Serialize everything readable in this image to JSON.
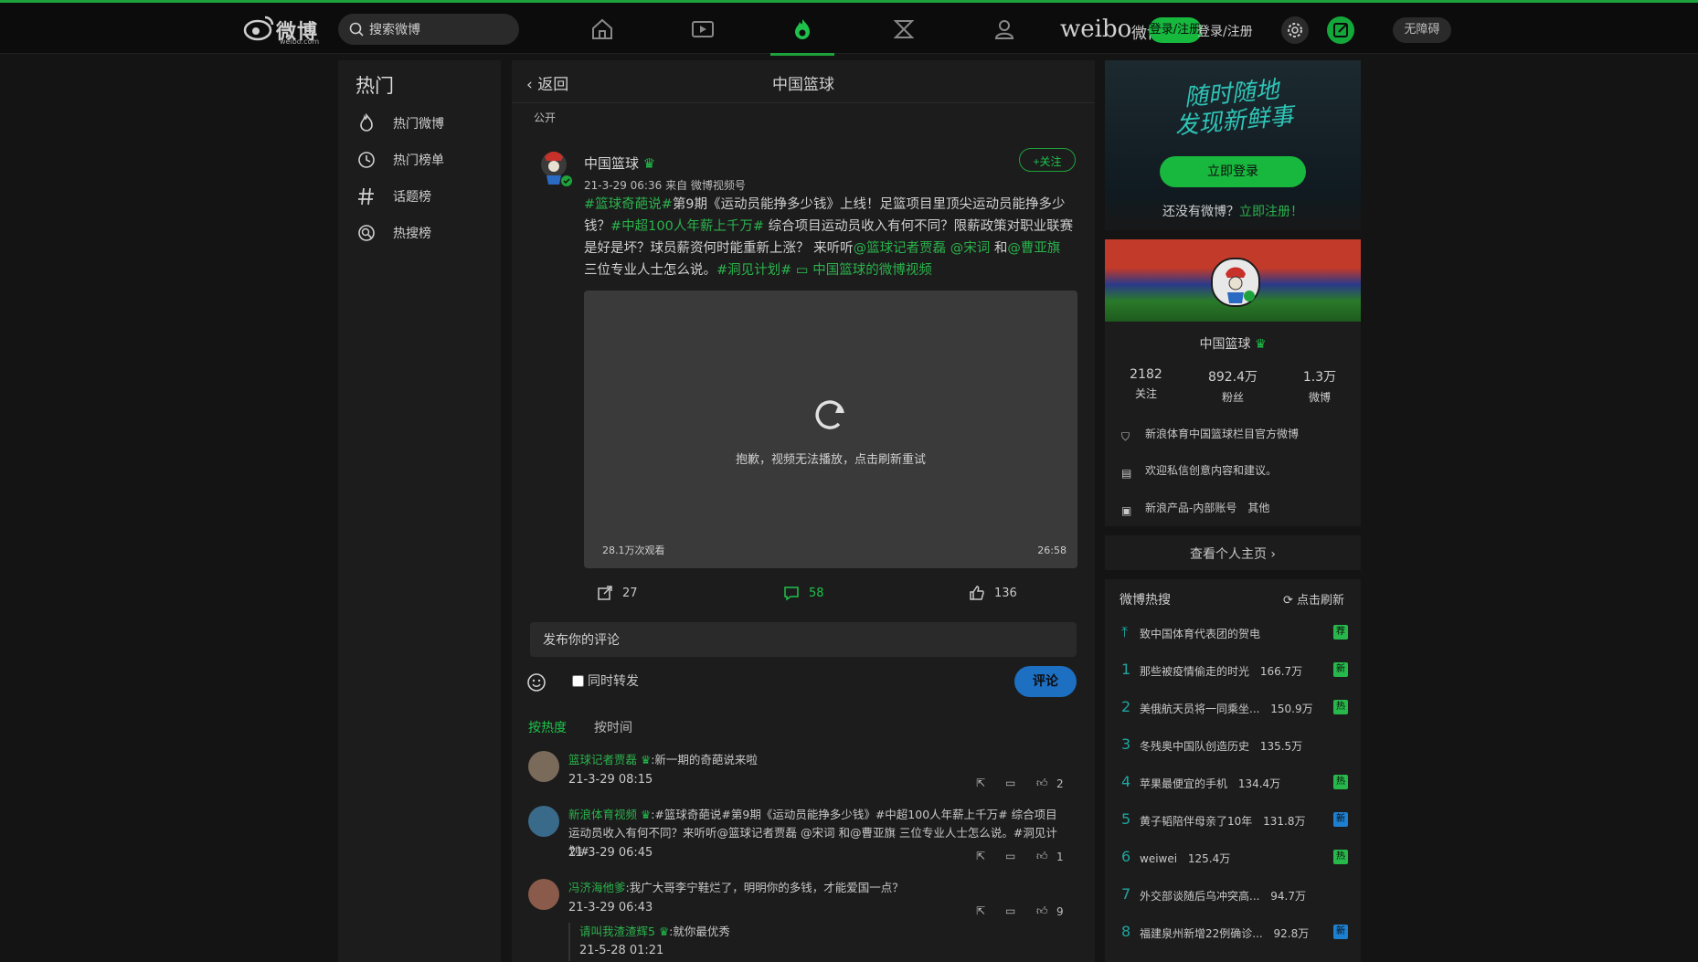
{
  "header": {
    "logo_text": "微博",
    "logo_sub": "weibo.com",
    "search_placeholder": "搜索微博",
    "brand": "weibo",
    "brand_cn": "微博",
    "login_pill": "登录/注册",
    "login_links": "登录/注册",
    "sound_label": "无障碍"
  },
  "left": {
    "title": "热门",
    "items": [
      {
        "label": "热门微博",
        "icon": "fire-icon"
      },
      {
        "label": "热门榜单",
        "icon": "clock-icon"
      },
      {
        "label": "话题榜",
        "icon": "hashtag-icon"
      },
      {
        "label": "热搜榜",
        "icon": "search-circle-icon"
      }
    ]
  },
  "post": {
    "back_label": "返回",
    "title": "中国篮球",
    "visibility": "公开",
    "author": "中国篮球",
    "time": "21-3-29 06:36",
    "source": "来自 微博视频号",
    "follow_label": "+关注",
    "text_segments": [
      {
        "t": "#篮球奇葩说#",
        "link": true
      },
      {
        "t": "第9期《运动员能挣多少钱》上线！足篮项目里顶尖运动员能挣多少钱？",
        "link": false
      },
      {
        "t": "#中超100人年薪上千万#",
        "link": true
      },
      {
        "t": " 综合项目运动员收入有何不同？限薪政策对职业联赛是好是坏？球员薪资何时能重新上涨？ 来听听",
        "link": false
      },
      {
        "t": "@篮球记者贾磊",
        "link": true
      },
      {
        "t": " ",
        "link": false
      },
      {
        "t": "@宋词",
        "link": true
      },
      {
        "t": " 和",
        "link": false
      },
      {
        "t": "@曹亚旗",
        "link": true
      },
      {
        "t": " 三位专业人士怎么说。",
        "link": false
      },
      {
        "t": "#洞见计划#",
        "link": true
      },
      {
        "t": " ",
        "link": false
      },
      {
        "t": "▭ 中国篮球的微博视频",
        "link": true
      }
    ],
    "video_message": "抱歉，视频无法播放，点击刷新重试",
    "video_views": "28.1万次观看",
    "video_duration": "26:58",
    "reposts": "27",
    "comments": "58",
    "likes": "136",
    "comment_placeholder": "发布你的评论",
    "forward_label": "同时转发",
    "submit_label": "评论",
    "sort_hot": "按热度",
    "sort_time": "按时间"
  },
  "comments": [
    {
      "user": "篮球记者贾磊",
      "text": ":新一期的奇葩说来啦",
      "time": "21-3-29 08:15",
      "likes": "2"
    },
    {
      "user": "新浪体育视频",
      "text": ":#篮球奇葩说#第9期《运动员能挣多少钱》#中超100人年薪上千万# 综合项目运动员收入有何不同？来听听@篮球记者贾磊 @宋词 和@曹亚旗 三位专业人士怎么说。#洞见计划#",
      "time": "21-3-29 06:45",
      "likes": "1"
    },
    {
      "user": "冯济海他爹",
      "text": ":我广大哥李宁鞋烂了，明明你的多钱，才能爱国一点？",
      "time": "21-3-29 06:43",
      "likes": "9"
    }
  ],
  "reply": {
    "user": "请叫我渣渣辉5",
    "text": ":就你最优秀",
    "time": "21-5-28 01:21"
  },
  "right": {
    "slogan_line1": "随时随地",
    "slogan_line2": "发现新鲜事",
    "login_button": "立即登录",
    "no_account": "还没有微博？",
    "register": "立即注册！",
    "profile_name": "中国篮球",
    "stats": [
      {
        "value": "2182",
        "label": "关注"
      },
      {
        "value": "892.4万",
        "label": "粉丝"
      },
      {
        "value": "1.3万",
        "label": "微博"
      }
    ],
    "info": [
      {
        "text": "新浪体育中国篮球栏目官方微博",
        "icon": "shield-icon"
      },
      {
        "text": "欢迎私信创意内容和建议。",
        "icon": "document-icon"
      },
      {
        "text": "新浪产品-内部账号　其他",
        "icon": "card-icon"
      }
    ],
    "view_home": "查看个人主页",
    "hot_title": "微博热搜",
    "hot_refresh": "点击刷新",
    "hot_items": [
      {
        "rank": "",
        "title": "致中国体育代表团的贺电",
        "heat": "",
        "badge": "荐",
        "badge_color": "#27b84b"
      },
      {
        "rank": "1",
        "title": "那些被疫情偷走的时光",
        "heat": "166.7万",
        "badge": "新",
        "badge_color": "#27b84b"
      },
      {
        "rank": "2",
        "title": "美俄航天员将一同乘坐...",
        "heat": "150.9万",
        "badge": "热",
        "badge_color": "#27b84b"
      },
      {
        "rank": "3",
        "title": "冬残奥中国队创造历史",
        "heat": "135.5万",
        "badge": "",
        "badge_color": ""
      },
      {
        "rank": "4",
        "title": "苹果最便宜的手机",
        "heat": "134.4万",
        "badge": "热",
        "badge_color": "#27b84b"
      },
      {
        "rank": "5",
        "title": "黄子韬陪伴母亲了10年",
        "heat": "131.8万",
        "badge": "新",
        "badge_color": "#1d7fd0"
      },
      {
        "rank": "6",
        "title": "weiwei",
        "heat": "125.4万",
        "badge": "热",
        "badge_color": "#27b84b"
      },
      {
        "rank": "7",
        "title": "外交部谈随后乌冲突高...",
        "heat": "94.7万",
        "badge": "",
        "badge_color": ""
      },
      {
        "rank": "8",
        "title": "福建泉州新增22例确诊...",
        "heat": "92.8万",
        "badge": "新",
        "badge_color": "#1d7fd0"
      }
    ]
  }
}
